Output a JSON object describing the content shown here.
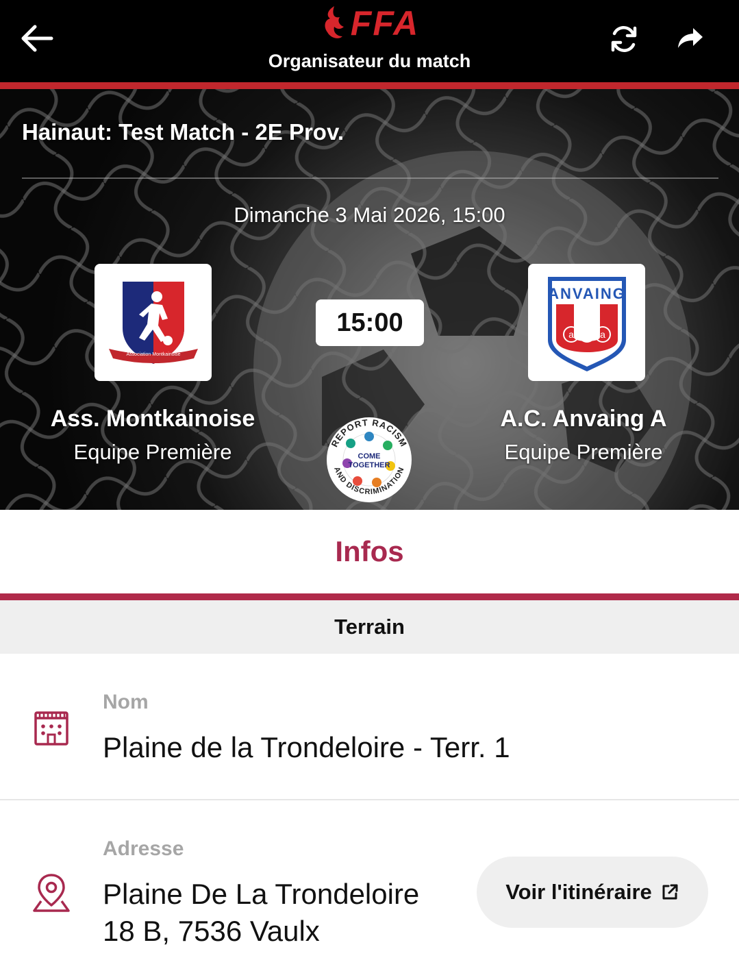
{
  "header": {
    "logo_text": "FFA",
    "title": "Organisateur du match",
    "icons": [
      "back-arrow-icon",
      "refresh-icon",
      "share-icon"
    ]
  },
  "match": {
    "competition": "Hainaut: Test Match - 2E Prov.",
    "date": "Dimanche 3 Mai 2026, 15:00",
    "time": "15:00",
    "home": {
      "name": "Ass. Montkainoise",
      "team": "Equipe Première",
      "logo_text": "Association Montkainoise"
    },
    "away": {
      "name": "A.C. Anvaing A",
      "team": "Equipe Première",
      "logo_top": "ANVAING",
      "logo_letters": [
        "a",
        "c",
        "a"
      ]
    },
    "badge": {
      "ring_top": "REPORT RACISM",
      "ring_bottom": "AND DISCRIMINATION",
      "center_line1": "COME",
      "center_line2": "TOGETHER"
    }
  },
  "tabs": {
    "active": "Infos"
  },
  "section": {
    "title": "Terrain"
  },
  "terrain": {
    "name_label": "Nom",
    "name_value": "Plaine de la Trondeloire - Terr. 1",
    "address_label": "Adresse",
    "address_line1": "Plaine De La Trondeloire",
    "address_line2": "18 B, 7536 Vaulx",
    "route_button": "Voir l'itinéraire"
  },
  "colors": {
    "brand_red": "#c1272d",
    "accent": "#a8294f",
    "header_bg": "#000000",
    "section_bg": "#efefef"
  }
}
